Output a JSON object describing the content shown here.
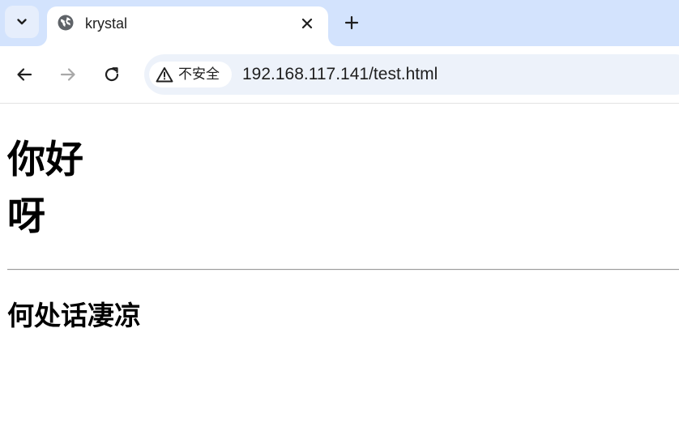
{
  "tab": {
    "title": "krystal",
    "favicon": "globe-icon"
  },
  "toolbar": {
    "security_label": "不安全",
    "url": "192.168.117.141/test.html"
  },
  "page": {
    "heading_line1": "你好",
    "heading_line2": "呀",
    "subheading": "何处话凄凉"
  },
  "colors": {
    "tabstrip": "#d3e3fd",
    "omnibox": "#edf2fa",
    "text": "#000000"
  }
}
